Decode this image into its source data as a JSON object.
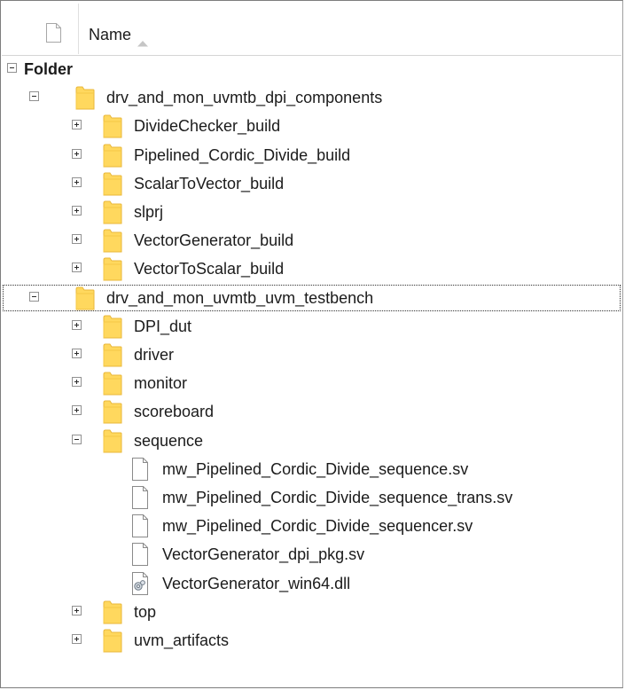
{
  "header": {
    "name_label": "Name"
  },
  "tree": [
    {
      "label": "Folder",
      "level": 0,
      "kind": "group",
      "state": "expanded"
    },
    {
      "label": "drv_and_mon_uvmtb_dpi_components",
      "level": 1,
      "kind": "folder",
      "state": "expanded"
    },
    {
      "label": "DivideChecker_build",
      "level": 2,
      "kind": "folder",
      "state": "collapsed"
    },
    {
      "label": "Pipelined_Cordic_Divide_build",
      "level": 2,
      "kind": "folder",
      "state": "collapsed"
    },
    {
      "label": "ScalarToVector_build",
      "level": 2,
      "kind": "folder",
      "state": "collapsed"
    },
    {
      "label": "slprj",
      "level": 2,
      "kind": "folder",
      "state": "collapsed"
    },
    {
      "label": "VectorGenerator_build",
      "level": 2,
      "kind": "folder",
      "state": "collapsed"
    },
    {
      "label": "VectorToScalar_build",
      "level": 2,
      "kind": "folder",
      "state": "collapsed"
    },
    {
      "label": "drv_and_mon_uvmtb_uvm_testbench",
      "level": 1,
      "kind": "folder",
      "state": "expanded",
      "focused": true
    },
    {
      "label": "DPI_dut",
      "level": 2,
      "kind": "folder",
      "state": "collapsed"
    },
    {
      "label": "driver",
      "level": 2,
      "kind": "folder",
      "state": "collapsed"
    },
    {
      "label": "monitor",
      "level": 2,
      "kind": "folder",
      "state": "collapsed"
    },
    {
      "label": "scoreboard",
      "level": 2,
      "kind": "folder",
      "state": "collapsed"
    },
    {
      "label": "sequence",
      "level": 2,
      "kind": "folder",
      "state": "expanded"
    },
    {
      "label": "mw_Pipelined_Cordic_Divide_sequence.sv",
      "level": 3,
      "kind": "file"
    },
    {
      "label": "mw_Pipelined_Cordic_Divide_sequence_trans.sv",
      "level": 3,
      "kind": "file"
    },
    {
      "label": "mw_Pipelined_Cordic_Divide_sequencer.sv",
      "level": 3,
      "kind": "file"
    },
    {
      "label": "VectorGenerator_dpi_pkg.sv",
      "level": 3,
      "kind": "file"
    },
    {
      "label": "VectorGenerator_win64.dll",
      "level": 3,
      "kind": "dll"
    },
    {
      "label": "top",
      "level": 2,
      "kind": "folder",
      "state": "collapsed"
    },
    {
      "label": "uvm_artifacts",
      "level": 2,
      "kind": "folder",
      "state": "collapsed"
    }
  ],
  "colors": {
    "folder": "#ffd85e",
    "folder_edge": "#e9b73a",
    "file_border": "#8a8a8a",
    "focus": "#333333"
  },
  "icons": {
    "header_check": "blank-page-icon",
    "sort": "sort-ascending-icon",
    "folder": "folder-icon",
    "file": "file-icon",
    "dll": "dll-file-icon"
  }
}
